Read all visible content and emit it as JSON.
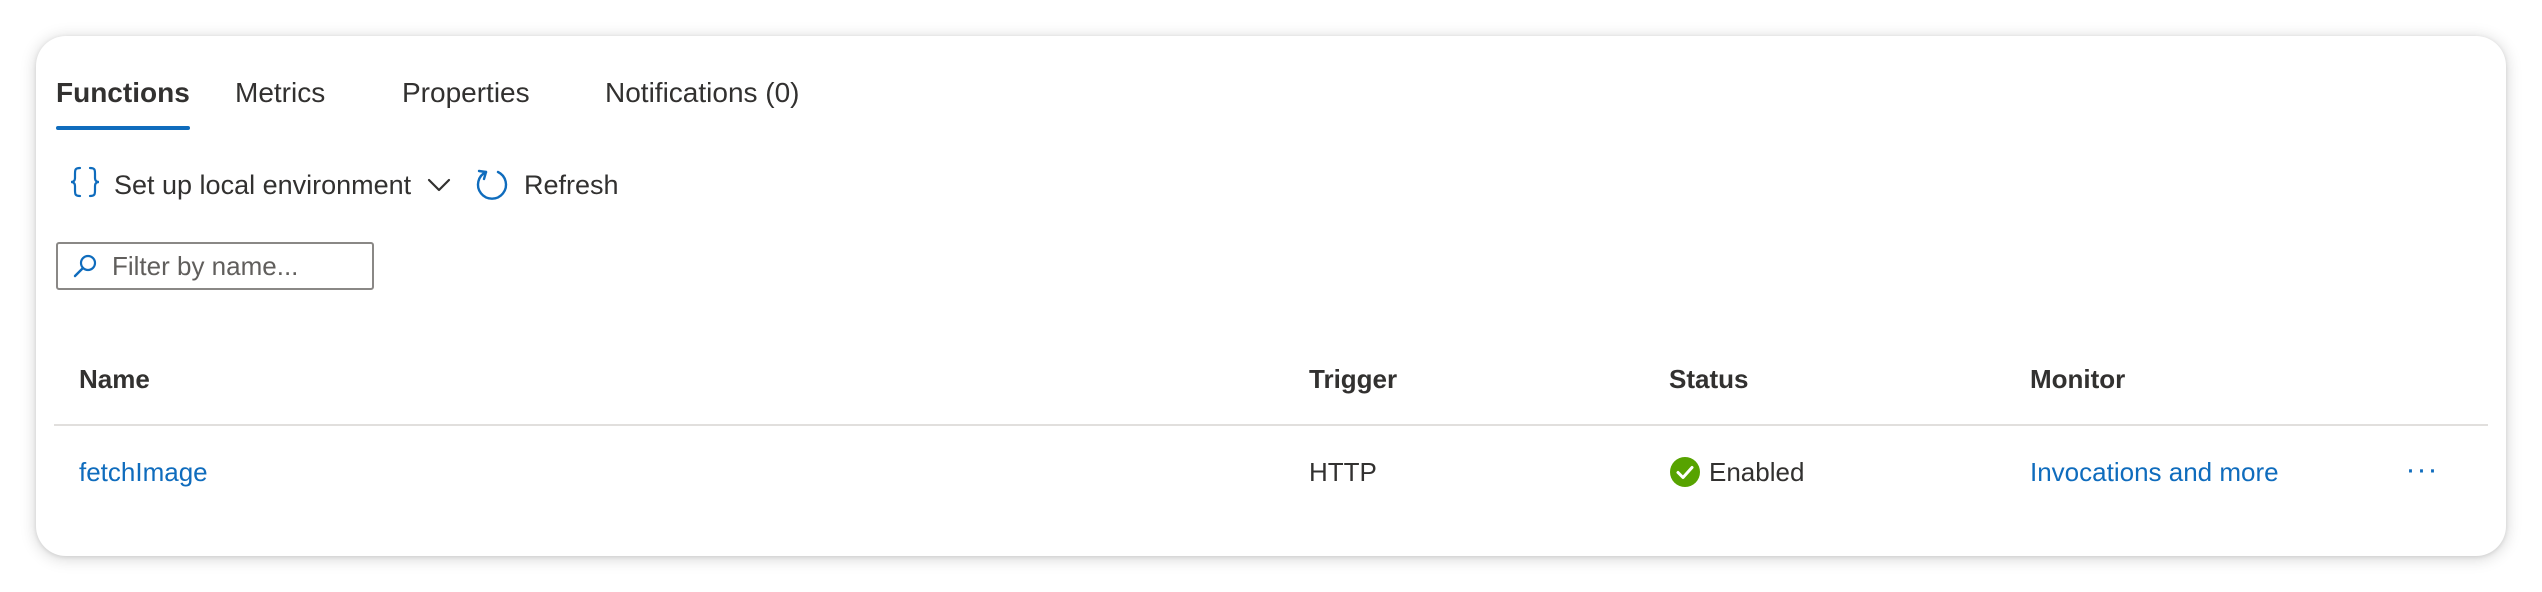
{
  "tabs": [
    {
      "label": "Functions",
      "active": true
    },
    {
      "label": "Metrics",
      "active": false
    },
    {
      "label": "Properties",
      "active": false
    },
    {
      "label": "Notifications (0)",
      "active": false
    }
  ],
  "toolbar": {
    "setup_label": "Set up local environment",
    "setup_icon": "braces-icon",
    "refresh_label": "Refresh",
    "refresh_icon": "refresh-icon"
  },
  "search": {
    "placeholder": "Filter by name...",
    "value": ""
  },
  "table": {
    "columns": [
      "Name",
      "Trigger",
      "Status",
      "Monitor"
    ],
    "rows": [
      {
        "name": "fetchImage",
        "trigger": "HTTP",
        "status": "Enabled",
        "monitor": "Invocations and more",
        "more": "···"
      }
    ]
  },
  "colors": {
    "accent": "#0f6cbd",
    "status_enabled": "#57a300",
    "text": "#323130"
  }
}
